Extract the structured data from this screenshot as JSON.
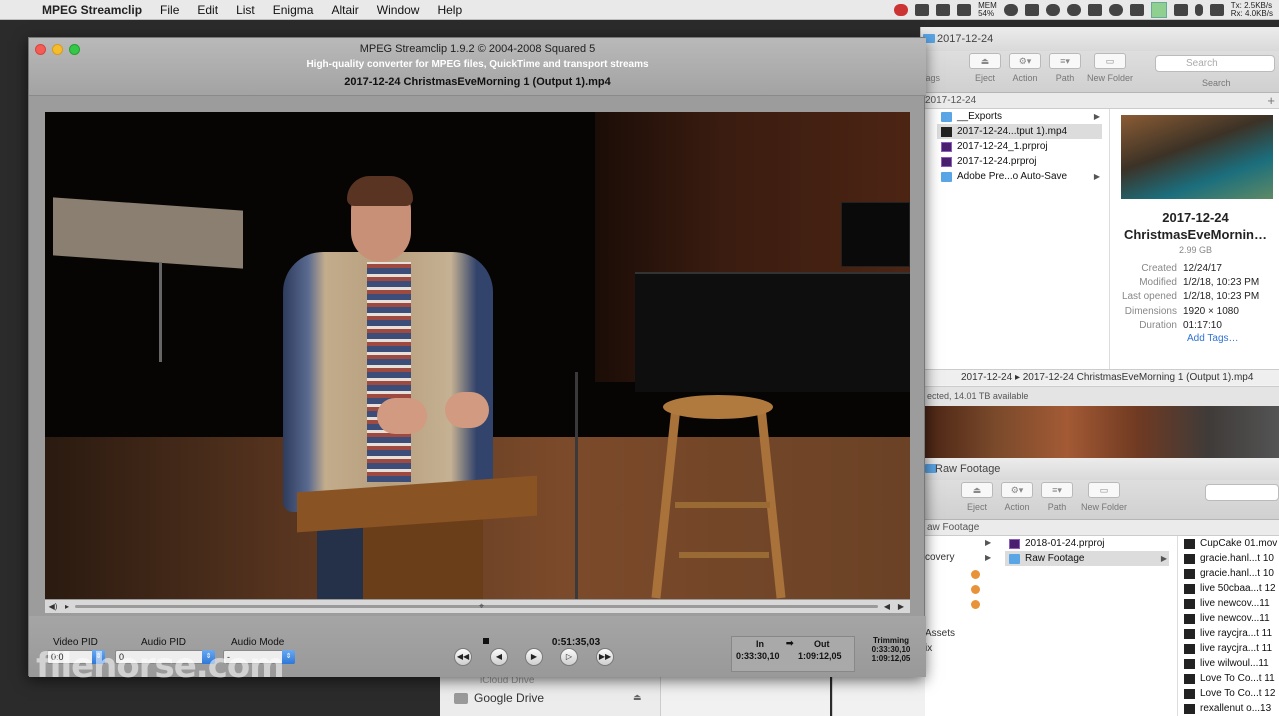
{
  "menubar": {
    "app_name": "MPEG Streamclip",
    "items": [
      "File",
      "Edit",
      "List",
      "Enigma",
      "Altair",
      "Window",
      "Help"
    ],
    "status": {
      "battery_top": "MEM",
      "battery_bottom": "54%",
      "net_tx": "Tx: 2.5KB/s",
      "net_rx": "Rx: 4.0KB/s"
    }
  },
  "mpeg": {
    "title": "MPEG Streamclip 1.9.2 © 2004-2008 Squared 5",
    "subtitle": "High-quality converter for MPEG files, QuickTime and transport streams",
    "filename": "2017-12-24 ChristmasEveMorning 1 (Output 1).mp4",
    "video_pid_label": "Video PID",
    "video_pid_value": "0:0",
    "audio_pid_label": "Audio PID",
    "audio_pid_value": "0",
    "audio_mode_label": "Audio Mode",
    "audio_mode_value": "-",
    "timecode": "0:51:35,03",
    "in_label": "In",
    "in_value": "0:33:30,10",
    "out_label": "Out",
    "out_value": "1:09:12,05",
    "trimming_label": "Trimming",
    "trimming_in": "0:33:30,10",
    "trimming_out": "1:09:12,05"
  },
  "finder_top": {
    "title": "2017-12-24",
    "toolbar": [
      "Eject",
      "Action",
      "Path",
      "New Folder"
    ],
    "tags_label": "Tags",
    "search_placeholder": "Search",
    "search_label": "Search",
    "path": "2017-12-24",
    "files": [
      {
        "name": "__Exports",
        "kind": "folder"
      },
      {
        "name": "2017-12-24...tput 1).mp4",
        "kind": "video"
      },
      {
        "name": "2017-12-24_1.prproj",
        "kind": "premiere"
      },
      {
        "name": "2017-12-24.prproj",
        "kind": "premiere"
      },
      {
        "name": "Adobe Pre...o Auto-Save",
        "kind": "folder"
      }
    ],
    "preview": {
      "name_line1": "2017-12-24",
      "name_line2": "ChristmasEveMornin…",
      "size": "2.99 GB",
      "meta": [
        {
          "k": "Created",
          "v": "12/24/17"
        },
        {
          "k": "Modified",
          "v": "1/2/18, 10:23 PM"
        },
        {
          "k": "Last opened",
          "v": "1/2/18, 10:23 PM"
        },
        {
          "k": "Dimensions",
          "v": "1920 × 1080"
        },
        {
          "k": "Duration",
          "v": "01:17:10"
        }
      ],
      "add_tags": "Add Tags…"
    },
    "pathbar_folder": "2017-12-24",
    "pathbar_file": "2017-12-24 ChristmasEveMorning 1 (Output 1).mp4",
    "status": "ected, 14.01 TB available"
  },
  "finder_bottom": {
    "title": "Raw Footage",
    "toolbar": [
      "Eject",
      "Action",
      "Path",
      "New Folder"
    ],
    "path": "aw Footage",
    "sidebar": [
      "covery",
      "Assets",
      "ix"
    ],
    "col2": [
      {
        "name": "2018-01-24.prproj",
        "kind": "premiere"
      },
      {
        "name": "Raw Footage",
        "kind": "folder"
      }
    ],
    "col3": [
      "CupCake 01.mov",
      "gracie.hanl...t 10",
      "gracie.hanl...t 10",
      "live 50cbaa...t 12",
      "live newcov...11",
      "live newcov...11",
      "live raycjra...t 11",
      "live raycjra...t 11",
      "live wilwoul...11",
      "Love To Co...t 11",
      "Love To Co...t 12",
      "rexallenut o...13"
    ]
  },
  "sidebar_remnant": {
    "google_drive": "Google Drive",
    "icloud": "iCloud Drive"
  },
  "watermark": "filehorse.com"
}
